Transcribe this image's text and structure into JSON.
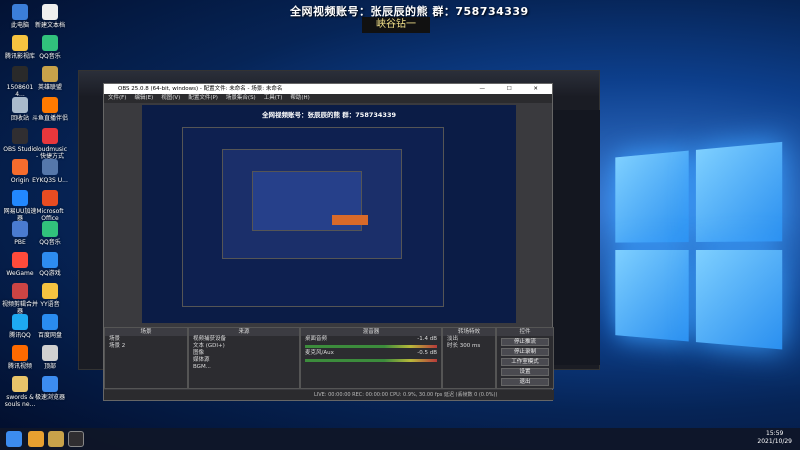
{
  "banner": {
    "line1": "全网视频账号：张辰辰的熊  群：758734339",
    "line2": "峡谷钻一"
  },
  "desktop_icons": [
    {
      "label": "此电脑",
      "color": "#3b7ed8"
    },
    {
      "label": "新建文本档",
      "color": "#eeeeee"
    },
    {
      "label": "腾讯影视库",
      "color": "#f6c340"
    },
    {
      "label": "QQ音乐",
      "color": "#31c27c"
    },
    {
      "label": "1508601 4...",
      "color": "#2a2a2a"
    },
    {
      "label": "英雄联盟",
      "color": "#c8a24a"
    },
    {
      "label": "回收站",
      "color": "#aabbcc"
    },
    {
      "label": "斗鱼直播伴侣",
      "color": "#ff7a00"
    },
    {
      "label": "OBS Studio",
      "color": "#302e31"
    },
    {
      "label": "cloudmusic - 快捷方式",
      "color": "#e8373c"
    },
    {
      "label": "Origin",
      "color": "#f56c2d"
    },
    {
      "label": "EYKQ3S U...",
      "color": "#5577aa"
    },
    {
      "label": "网易UU加速器",
      "color": "#2288ff"
    },
    {
      "label": "Microsoft Office",
      "color": "#e84c22"
    },
    {
      "label": "PBE",
      "color": "#4a7bd0"
    },
    {
      "label": "QQ音乐",
      "color": "#31c27c"
    },
    {
      "label": "WeGame",
      "color": "#ff4b3b"
    },
    {
      "label": "QQ游戏",
      "color": "#2d8cf0"
    },
    {
      "label": "视频剪辑合并器",
      "color": "#cc4444"
    },
    {
      "label": "YY语音",
      "color": "#f6c340"
    },
    {
      "label": "腾讯QQ",
      "color": "#1eaaf1"
    },
    {
      "label": "百度网盘",
      "color": "#2a8cf0"
    },
    {
      "label": "腾讯视频",
      "color": "#ff6a00"
    },
    {
      "label": "顶部",
      "color": "#d0d0d0"
    },
    {
      "label": "swords & souls ne...",
      "color": "#e8c46a"
    },
    {
      "label": "极速浏览器",
      "color": "#3c8cf0"
    }
  ],
  "obs": {
    "title": "OBS 25.0.8 (64-bit, windows) - 配置文件: 未命名 - 场景: 未命名",
    "menu": [
      "文件(F)",
      "编辑(E)",
      "视图(V)",
      "配置文件(P)",
      "场景集合(S)",
      "工具(T)",
      "帮助(H)"
    ],
    "preview_banner": "全网视频账号：张辰辰的熊  群：758734339",
    "docks": {
      "scenes": {
        "title": "场景",
        "items": [
          "场景",
          "场景 2"
        ]
      },
      "sources": {
        "title": "来源",
        "items": [
          "视频捕获设备",
          "文本 (GDI+)",
          "图像",
          "媒体源",
          "BGM..."
        ]
      },
      "mixer": {
        "title": "混音器",
        "tracks": [
          {
            "name": "桌面音频",
            "db": "-1.4 dB"
          },
          {
            "name": "麦克风/Aux",
            "db": "-0.5 dB"
          }
        ]
      },
      "transitions": {
        "title": "转场特效",
        "type": "淡出",
        "duration_label": "时长",
        "duration": "300 ms"
      },
      "controls": {
        "title": "控件",
        "buttons": [
          "停止推流",
          "停止录制",
          "工作室模式",
          "设置",
          "退出"
        ]
      }
    },
    "status": "LIVE: 00:00:00   REC: 00:00:00   CPU: 0.9%, 30.00 fps   延迟 (丢帧数 0 (0.0%))"
  },
  "taskbar": {
    "time": "15:59",
    "date": "2021/10/29"
  }
}
